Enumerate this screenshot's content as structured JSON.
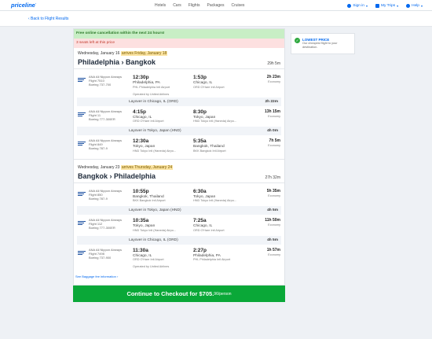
{
  "header": {
    "logo": "priceline",
    "nav": [
      "Hotels",
      "Cars",
      "Flights",
      "Packages",
      "Cruises"
    ],
    "signin": "Sign in",
    "mytrips": "My Trips",
    "help": "Help"
  },
  "back_link": "‹ Back to Flight Results",
  "banners": {
    "green": "Free online cancellation within the next 24 hours!",
    "red": "3 seats left at this price"
  },
  "sidebar": {
    "title": "LOWEST PRICE",
    "text": "Our cheapest flight to your destination."
  },
  "outbound": {
    "date": "Wednesday, January 16",
    "arrives": "arrives Friday, January 18",
    "route": "Philadelphia › Bangkok",
    "duration": "29h 5m",
    "segments": [
      {
        "airline": "ANA All Nippon Airways",
        "flight": "Flight 7510",
        "aircraft": "Boeing 737-700",
        "dep_time": "12:30p",
        "dep_city": "Philadelphia, PA",
        "dep_airport": "PHL Philadelphia Intl Airport",
        "arr_time": "1:53p",
        "arr_city": "Chicago, IL",
        "arr_airport": "ORD O'Hare Intl Airport",
        "duration": "2h 23m",
        "cabin": "Economy",
        "operated": "Operated by United Airlines"
      },
      {
        "airline": "ANA All Nippon Airways",
        "flight": "Flight 11",
        "aircraft": "Boeing 777-300ER",
        "dep_time": "4:15p",
        "dep_city": "Chicago, IL",
        "dep_airport": "ORD O'Hare Intl Airport",
        "arr_time": "8:30p",
        "arr_city": "Tokyo, Japan",
        "arr_airport": "HND Tokyo Intl (Haneda) Airpo...",
        "duration": "13h 15m",
        "cabin": "Economy",
        "operated": ""
      },
      {
        "airline": "ANA All Nippon Airways",
        "flight": "Flight 849",
        "aircraft": "Boeing 787-9",
        "dep_time": "12:30a",
        "dep_city": "Tokyo, Japan",
        "dep_airport": "HND Tokyo Intl (Haneda) Airpo...",
        "arr_time": "5:35a",
        "arr_city": "Bangkok, Thailand",
        "arr_airport": "BKK Bangkok Intl Airport",
        "duration": "7h 5m",
        "cabin": "Economy",
        "operated": ""
      }
    ],
    "layovers": [
      {
        "text": "Layover in Chicago, IL (ORD)",
        "duration": "2h 22m"
      },
      {
        "text": "Layover in Tokyo, Japan (HND)",
        "duration": "4h 0m"
      }
    ]
  },
  "return": {
    "date": "Wednesday, January 23",
    "arrives": "arrives Thursday, January 24",
    "route": "Bangkok › Philadelphia",
    "duration": "27h 32m",
    "segments": [
      {
        "airline": "ANA All Nippon Airways",
        "flight": "Flight 850",
        "aircraft": "Boeing 787-9",
        "dep_time": "10:55p",
        "dep_city": "Bangkok, Thailand",
        "dep_airport": "BKK Bangkok Intl Airport",
        "arr_time": "6:30a",
        "arr_city": "Tokyo, Japan",
        "arr_airport": "HND Tokyo Intl (Haneda) Airpo...",
        "duration": "5h 35m",
        "cabin": "Economy",
        "operated": ""
      },
      {
        "airline": "ANA All Nippon Airways",
        "flight": "Flight 112",
        "aircraft": "Boeing 777-300ER",
        "dep_time": "10:35a",
        "dep_city": "Tokyo, Japan",
        "dep_airport": "HND Tokyo Intl (Haneda) Airpo...",
        "arr_time": "7:25a",
        "arr_city": "Chicago, IL",
        "arr_airport": "ORD O'Hare Intl Airport",
        "duration": "11h 50m",
        "cabin": "Economy",
        "operated": ""
      },
      {
        "airline": "ANA All Nippon Airways",
        "flight": "Flight 7498",
        "aircraft": "Boeing 737-900",
        "dep_time": "11:30a",
        "dep_city": "Chicago, IL",
        "dep_airport": "ORD O'Hare Intl Airport",
        "arr_time": "2:27p",
        "arr_city": "Philadelphia, PA",
        "arr_airport": "PHL Philadelphia Intl Airport",
        "duration": "1h 57m",
        "cabin": "Economy",
        "operated": "Operated by United Airlines"
      }
    ],
    "layovers": [
      {
        "text": "Layover in Tokyo, Japan (HND)",
        "duration": "4h 5m"
      },
      {
        "text": "Layover in Chicago, IL (ORD)",
        "duration": "4h 5m"
      }
    ]
  },
  "baggage_link": "See Baggage fee information",
  "checkout": {
    "label": "Continue to Checkout for $705.",
    "cents": "96",
    "per": "/person"
  }
}
